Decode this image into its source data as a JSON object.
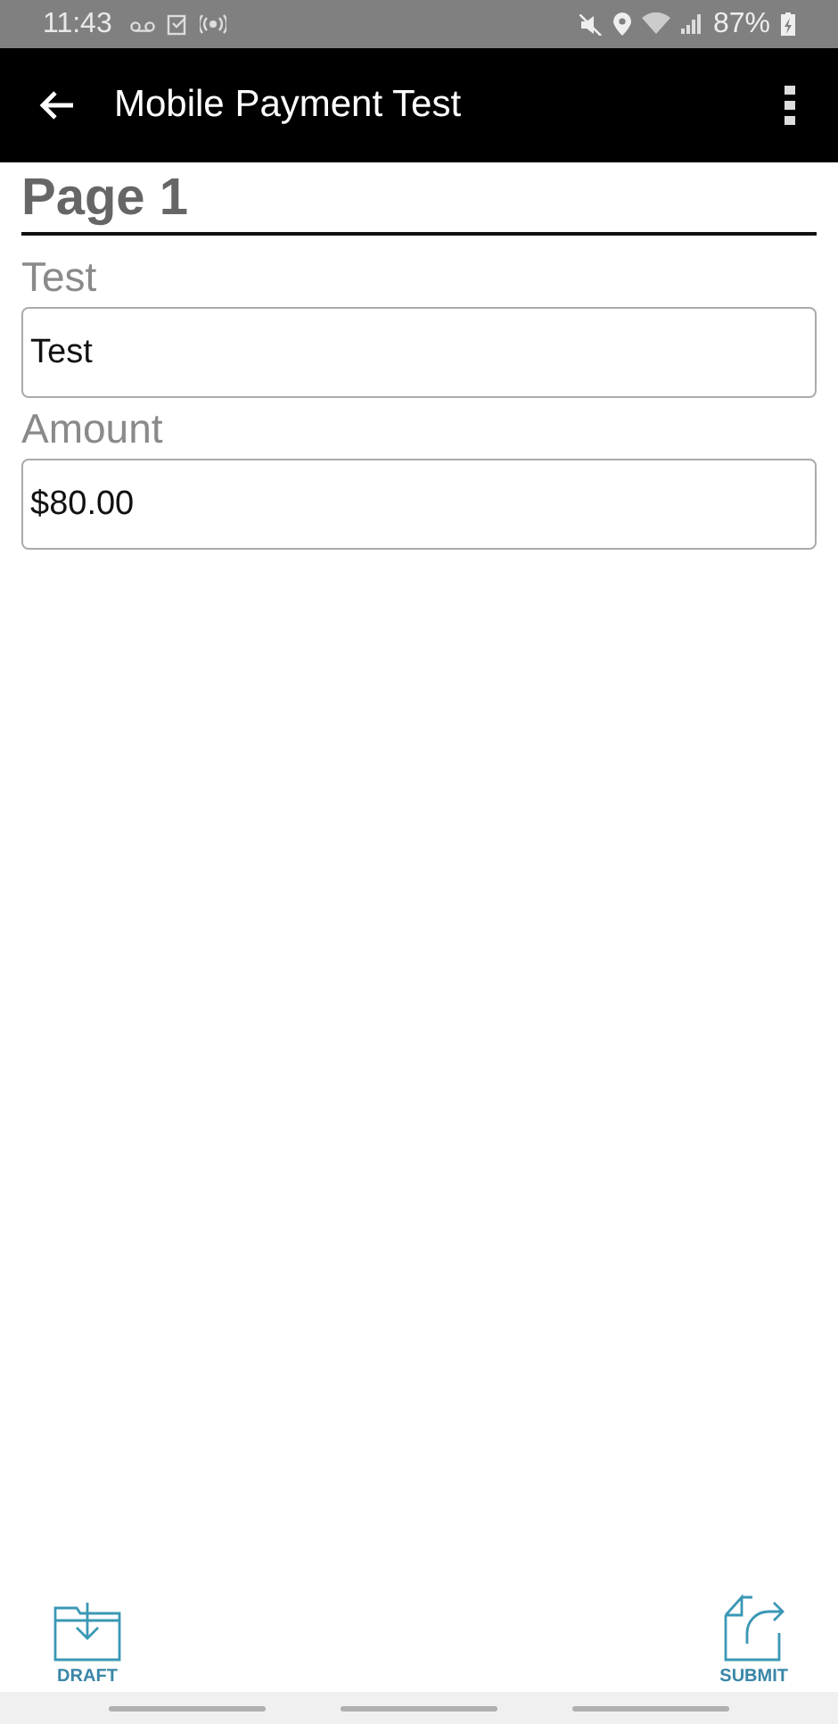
{
  "status_bar": {
    "time": "11:43",
    "battery": "87%"
  },
  "app_bar": {
    "title": "Mobile Payment Test"
  },
  "page": {
    "heading": "Page 1",
    "fields": [
      {
        "label": "Test",
        "value": "Test"
      },
      {
        "label": "Amount",
        "value": "$80.00"
      }
    ]
  },
  "actions": [
    {
      "kind": "draft",
      "label": "DRAFT"
    },
    {
      "kind": "submit",
      "label": "SUBMIT"
    }
  ]
}
